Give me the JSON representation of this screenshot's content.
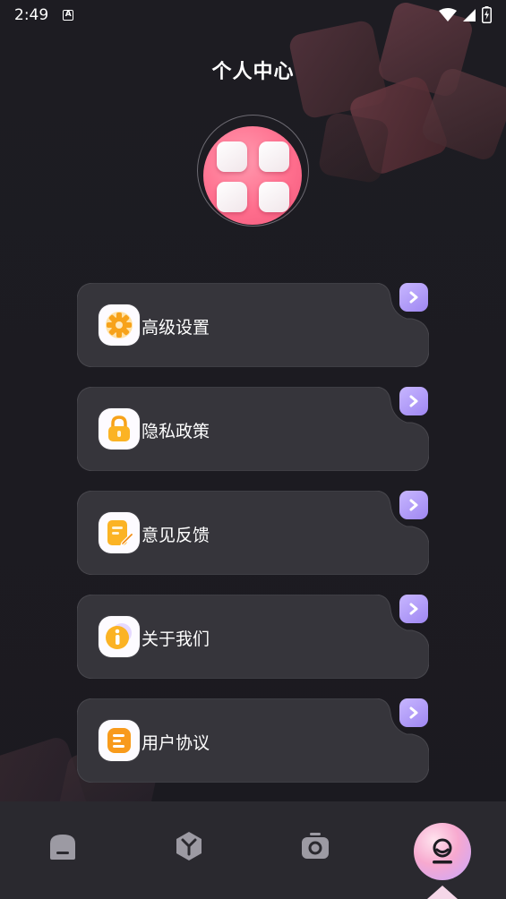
{
  "status_bar": {
    "time": "2:49",
    "notification_glyph": "A"
  },
  "page": {
    "title": "个人中心"
  },
  "menu": [
    {
      "label": "高级设置",
      "icon": "gear-icon"
    },
    {
      "label": "隐私政策",
      "icon": "lock-icon"
    },
    {
      "label": "意见反馈",
      "icon": "feedback-note-icon"
    },
    {
      "label": "关于我们",
      "icon": "info-icon"
    },
    {
      "label": "用户协议",
      "icon": "document-icon"
    }
  ],
  "bottom_nav": {
    "items": [
      "home-icon",
      "y-icon",
      "camera-icon",
      "profile-icon"
    ],
    "active": "profile-icon"
  },
  "colors": {
    "background": "#1c1b21",
    "card": "#36353b",
    "arrow_accent": "#a892f6",
    "avatar_pink": "#ff6f8e",
    "icon_orange": "#fba21f"
  }
}
